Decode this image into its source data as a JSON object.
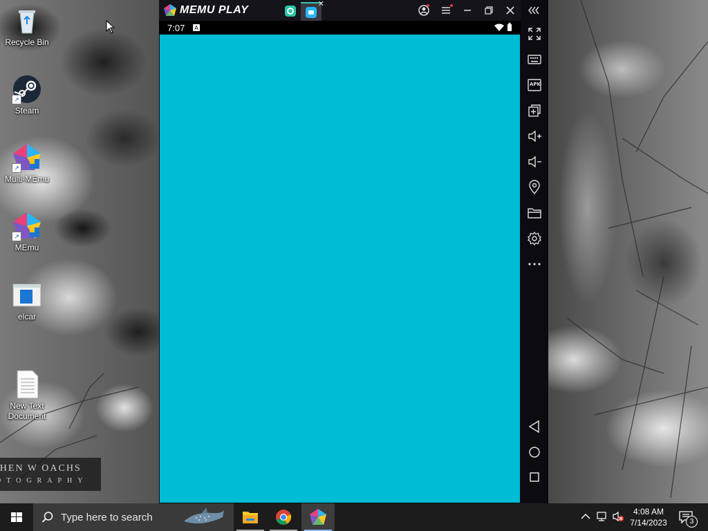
{
  "desktop": {
    "icons": [
      {
        "label": "Recycle Bin",
        "icon": "recycle-bin-icon"
      },
      {
        "label": "Steam",
        "icon": "steam-icon"
      },
      {
        "label": "Multi-MEmu",
        "icon": "multi-memu-icon"
      },
      {
        "label": "MEmu",
        "icon": "memu-icon"
      },
      {
        "label": "elcar",
        "icon": "window-file-icon"
      },
      {
        "label": "New Text\nDocument",
        "icon": "text-document-icon"
      }
    ],
    "watermark": {
      "line1": "PHEN W OACHS",
      "line2": "OTOGRAPHY"
    }
  },
  "emulator": {
    "title": "MEMU PLAY",
    "tabs": [
      {
        "icon": "android-home-tab-icon",
        "active": false
      },
      {
        "icon": "app-tab-icon",
        "active": true
      }
    ],
    "titlebar_buttons": [
      "account-icon",
      "menu-icon",
      "minimize-icon",
      "restore-icon",
      "close-icon",
      "collapse-sidebar-icon"
    ],
    "status_bar": {
      "time": "7:07"
    },
    "screen_color": "#00bcd4",
    "sidebar_buttons": [
      "fullscreen-icon",
      "keyboard-icon",
      "apk-icon",
      "multi-instance-icon",
      "volume-up-icon",
      "volume-down-icon",
      "location-icon",
      "folder-icon",
      "settings-icon",
      "more-icon"
    ],
    "nav_buttons": [
      "back-icon",
      "home-icon",
      "recents-icon"
    ],
    "apk_label": "APK"
  },
  "taskbar": {
    "search_placeholder": "Type here to search",
    "apps": [
      "file-explorer-icon",
      "chrome-icon",
      "memu-taskbar-icon"
    ],
    "clock": {
      "time": "4:08 AM",
      "date": "7/14/2023"
    },
    "notification_count": "3"
  }
}
